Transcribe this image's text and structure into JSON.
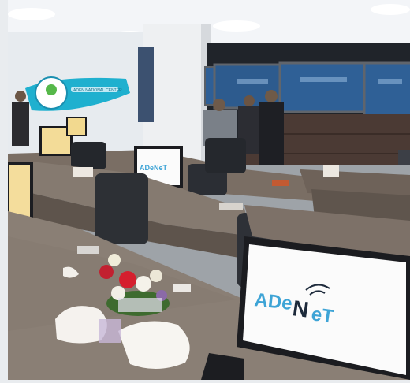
{
  "scene": {
    "monitor_brand_large": {
      "part1": "ADe",
      "part2": "N",
      "part3": "eT"
    },
    "monitor_brand_small": "ADeNeT",
    "wall_banner_text": "ADEN NATIONAL CENTER"
  },
  "colors": {
    "wall": "#e9ecef",
    "ceiling": "#f4f6f8",
    "desk": "#6e655d",
    "desk_top": "#857a70",
    "chair": "#2b2f35",
    "screen_blue": "#1f4f86",
    "logo_blue": "#3ea4d6",
    "logo_dark": "#1d2a3b",
    "banner_teal": "#1aa7c7"
  }
}
